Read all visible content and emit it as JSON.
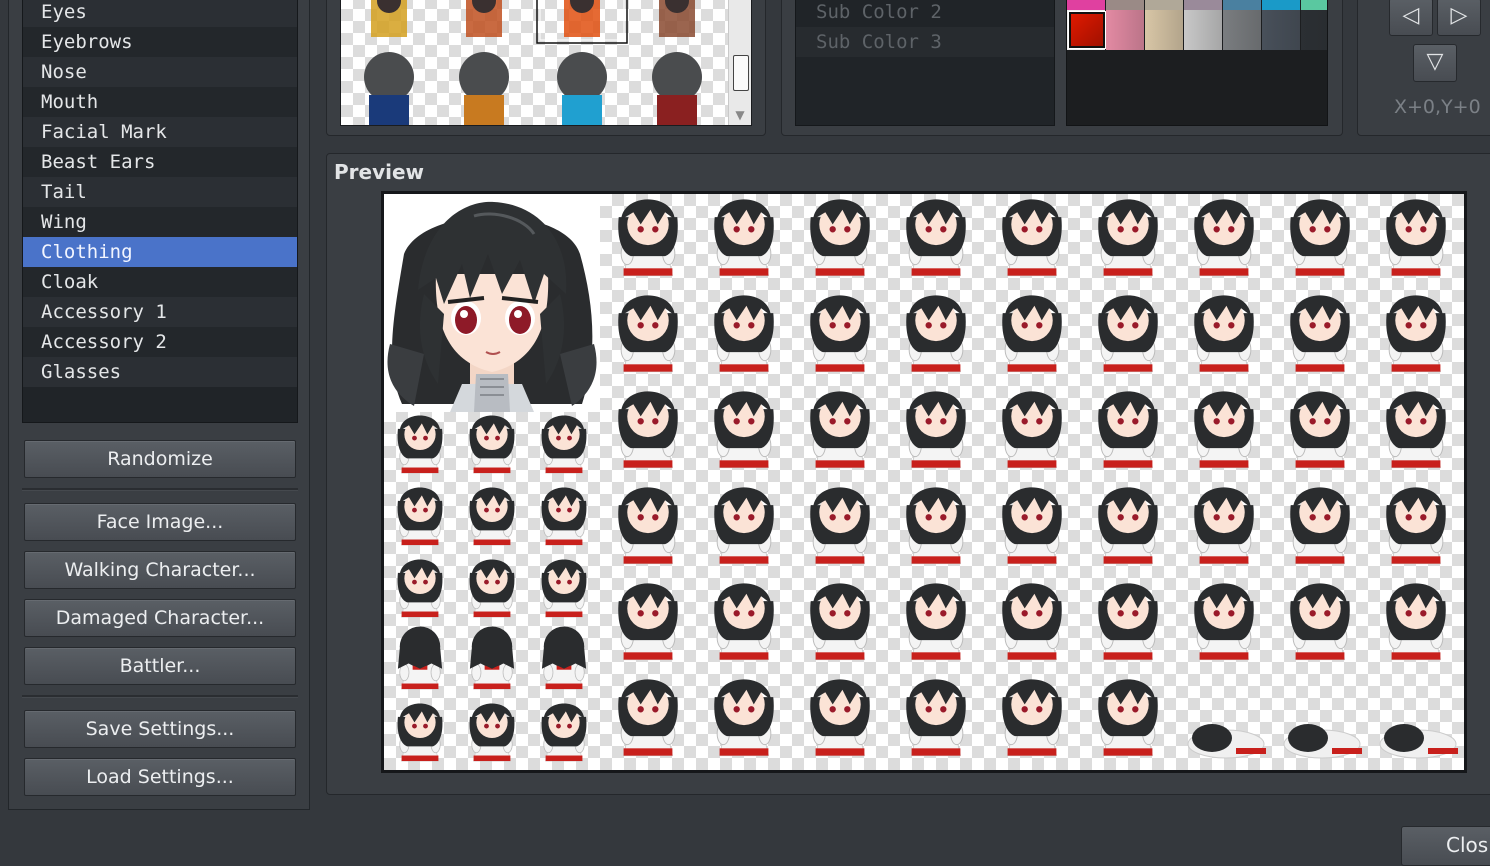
{
  "parts": {
    "items": [
      {
        "label": "Eyes",
        "selected": false
      },
      {
        "label": "Eyebrows",
        "selected": false
      },
      {
        "label": "Nose",
        "selected": false
      },
      {
        "label": "Mouth",
        "selected": false
      },
      {
        "label": "Facial Mark",
        "selected": false
      },
      {
        "label": "Beast Ears",
        "selected": false
      },
      {
        "label": "Tail",
        "selected": false
      },
      {
        "label": "Wing",
        "selected": false
      },
      {
        "label": "Clothing",
        "selected": true
      },
      {
        "label": "Cloak",
        "selected": false
      },
      {
        "label": "Accessory 1",
        "selected": false
      },
      {
        "label": "Accessory 2",
        "selected": false
      },
      {
        "label": "Glasses",
        "selected": false
      }
    ]
  },
  "buttons": {
    "randomize": "Randomize",
    "face_image": "Face Image...",
    "walking_character": "Walking Character...",
    "damaged_character": "Damaged Character...",
    "battler": "Battler...",
    "save_settings": "Save Settings...",
    "load_settings": "Load Settings...",
    "close": "Clos"
  },
  "colors": {
    "items": [
      "Sub Color 2",
      "Sub Color 3"
    ],
    "palette": [
      "#d3c",
      "#e38aa3",
      "#d8c6a6",
      "#c8c8c8",
      "#7a7d80",
      "#48505a",
      "#2b2f33"
    ],
    "palette_top": [
      "#e040a0",
      "#9a8a86",
      "#b0a898",
      "#9a8a9a",
      "#4a80a0",
      "#1a9ac8",
      "#5ac8a0"
    ],
    "selected_color": "#e01a00"
  },
  "position": {
    "offset_label": "X+0,Y+0",
    "left_arrow": "◁",
    "right_arrow": "▷",
    "down_arrow": "▽"
  },
  "preview": {
    "title": "Preview"
  },
  "theme": {
    "accent": "#4a73c9",
    "hair": "#2a2c2e",
    "dress": "#c8201c"
  }
}
